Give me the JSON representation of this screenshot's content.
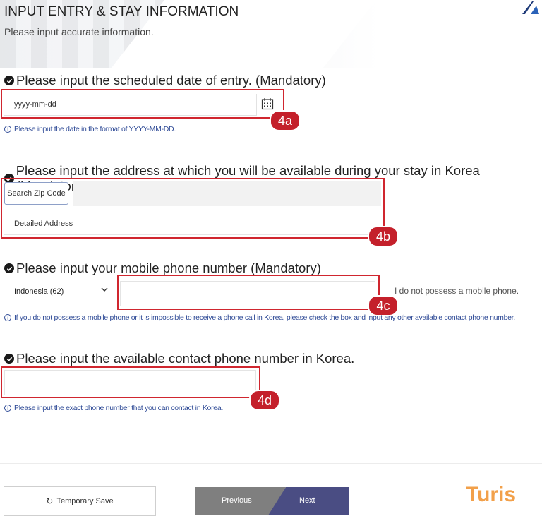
{
  "header": {
    "title": "INPUT ENTRY & STAY INFORMATION",
    "subtitle": "Please input accurate information."
  },
  "entry_date": {
    "heading": "Please input the scheduled date of entry. (Mandatory)",
    "placeholder": "yyyy-mm-dd",
    "note": "Please input the date in the format of YYYY-MM-DD.",
    "badge": "4a"
  },
  "address": {
    "heading": "Please input the address at which you will be available during your stay in Korea (Mandatory)",
    "zip_button": "Search Zip Code",
    "detailed_placeholder": "Detailed Address",
    "badge": "4b"
  },
  "mobile": {
    "heading": "Please input your mobile phone number (Mandatory)",
    "country_selected": "Indonesia (62)",
    "no_phone_label": "I do not possess a mobile phone.",
    "note": "If you do not possess a mobile phone or it is impossible to receive a phone call in Korea, please check the box and input any other available contact phone number.",
    "badge": "4c"
  },
  "contact": {
    "heading": "Please input the available contact phone number in Korea.",
    "note": "Please input the exact phone number that you can contact in Korea.",
    "badge": "4d"
  },
  "footer": {
    "temp_save": "Temporary Save",
    "previous": "Previous",
    "next": "Next",
    "brand": "Turis"
  },
  "icons": {
    "check": "check-circle-icon",
    "calendar": "calendar-icon",
    "info": "info-icon",
    "chevron": "chevron-down-icon",
    "refresh": "refresh-icon"
  },
  "colors": {
    "annotation_red": "#d0262f",
    "note_blue": "#2e4a96",
    "next_button": "#4a4d83",
    "previous_button": "#7f7f7f",
    "brand_orange": "#f2a04a"
  }
}
